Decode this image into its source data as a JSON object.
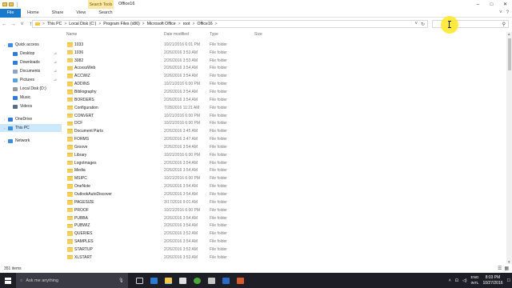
{
  "window": {
    "title": "Office16",
    "context_tab": "Search Tools",
    "controls": {
      "minimize": "–",
      "maximize": "□",
      "close": "✕"
    }
  },
  "ribbon": {
    "tabs": [
      "File",
      "Home",
      "Share",
      "View",
      "Search"
    ],
    "expand_icon": "˅",
    "help_icon": "?"
  },
  "address": {
    "back_icon": "←",
    "forward_icon": "→",
    "recent_icon": "˅",
    "up_icon": "↑",
    "breadcrumb": [
      "This PC",
      "Local Disk (C:)",
      "Program Files (x86)",
      "Microsoft Office",
      "root",
      "Office16"
    ],
    "separator": ">",
    "dropdown_icon": "˅",
    "refresh_icon": "↻",
    "search_icon": "⚲"
  },
  "nav": {
    "items": [
      {
        "label": "Quick access",
        "icon": "star-icon",
        "color": "#3d8ee8",
        "indent": 0,
        "pinned": false,
        "chevron": "›"
      },
      {
        "label": "Desktop",
        "icon": "desktop-icon",
        "color": "#2f7bd6",
        "indent": 1,
        "pinned": true
      },
      {
        "label": "Downloads",
        "icon": "download-icon",
        "color": "#2f7bd6",
        "indent": 1,
        "pinned": true
      },
      {
        "label": "Documents",
        "icon": "documents-icon",
        "color": "#8aa4c4",
        "indent": 1,
        "pinned": true
      },
      {
        "label": "Pictures",
        "icon": "pictures-icon",
        "color": "#5aa0e0",
        "indent": 1,
        "pinned": true
      },
      {
        "label": "Local Disk (D:)",
        "icon": "drive-icon",
        "color": "#9a9a9a",
        "indent": 1,
        "pinned": false
      },
      {
        "label": "Music",
        "icon": "music-icon",
        "color": "#2f7bd6",
        "indent": 1,
        "pinned": false
      },
      {
        "label": "Videos",
        "icon": "videos-icon",
        "color": "#5a6a80",
        "indent": 1,
        "pinned": false
      },
      {
        "label": "OneDrive",
        "icon": "onedrive-icon",
        "color": "#2f7bd6",
        "indent": 0,
        "pinned": false,
        "chevron": "›"
      },
      {
        "label": "This PC",
        "icon": "pc-icon",
        "color": "#3c8fd8",
        "indent": 0,
        "pinned": false,
        "chevron": "›",
        "selected": true
      },
      {
        "label": "Network",
        "icon": "network-icon",
        "color": "#3c8fd8",
        "indent": 0,
        "pinned": false,
        "chevron": "›"
      }
    ],
    "pin_glyph": "⊿"
  },
  "columns": {
    "name": "Name",
    "date": "Date modified",
    "type": "Type",
    "size": "Size"
  },
  "files": [
    {
      "name": "1033",
      "date": "10/21/2016 6:01 PM",
      "type": "File folder"
    },
    {
      "name": "1036",
      "date": "2/26/2016 3:53 AM",
      "type": "File folder"
    },
    {
      "name": "3082",
      "date": "2/26/2016 3:53 AM",
      "type": "File folder"
    },
    {
      "name": "AccessWeb",
      "date": "2/26/2016 3:54 AM",
      "type": "File folder"
    },
    {
      "name": "ACCWIZ",
      "date": "2/26/2016 3:54 AM",
      "type": "File folder"
    },
    {
      "name": "ADDINS",
      "date": "10/21/2016 6:00 PM",
      "type": "File folder"
    },
    {
      "name": "Bibliography",
      "date": "2/26/2016 3:54 AM",
      "type": "File folder"
    },
    {
      "name": "BORDERS",
      "date": "2/26/2016 3:54 AM",
      "type": "File folder"
    },
    {
      "name": "Configuration",
      "date": "7/28/2016 11:21 AM",
      "type": "File folder"
    },
    {
      "name": "CONVERT",
      "date": "10/21/2016 6:00 PM",
      "type": "File folder"
    },
    {
      "name": "DCF",
      "date": "10/21/2016 6:00 PM",
      "type": "File folder"
    },
    {
      "name": "Document Parts",
      "date": "2/26/2016 3:45 AM",
      "type": "File folder"
    },
    {
      "name": "FORMS",
      "date": "2/26/2016 3:47 AM",
      "type": "File folder"
    },
    {
      "name": "Groove",
      "date": "2/26/2016 3:54 AM",
      "type": "File folder"
    },
    {
      "name": "Library",
      "date": "10/21/2016 6:00 PM",
      "type": "File folder"
    },
    {
      "name": "LogoImages",
      "date": "2/26/2016 3:54 AM",
      "type": "File folder"
    },
    {
      "name": "Media",
      "date": "2/26/2016 3:54 AM",
      "type": "File folder"
    },
    {
      "name": "MSIPC",
      "date": "10/21/2016 6:00 PM",
      "type": "File folder"
    },
    {
      "name": "OneNote",
      "date": "2/26/2016 3:54 AM",
      "type": "File folder"
    },
    {
      "name": "OutlookAutoDiscover",
      "date": "2/26/2016 3:54 AM",
      "type": "File folder"
    },
    {
      "name": "PAGESIZE",
      "date": "3/17/2016 9:01 AM",
      "type": "File folder"
    },
    {
      "name": "PROOF",
      "date": "10/21/2016 6:00 PM",
      "type": "File folder"
    },
    {
      "name": "PUBBA",
      "date": "2/26/2016 3:54 AM",
      "type": "File folder"
    },
    {
      "name": "PUBWIZ",
      "date": "2/26/2016 3:54 AM",
      "type": "File folder"
    },
    {
      "name": "QUERIES",
      "date": "2/26/2016 3:52 AM",
      "type": "File folder"
    },
    {
      "name": "SAMPLES",
      "date": "2/26/2016 3:54 AM",
      "type": "File folder"
    },
    {
      "name": "STARTUP",
      "date": "2/26/2016 3:52 AM",
      "type": "File folder"
    },
    {
      "name": "XLSTART",
      "date": "2/26/2016 3:53 AM",
      "type": "File folder"
    }
  ],
  "status": {
    "item_count": "351 items"
  },
  "taskbar": {
    "search_placeholder": "Ask me anything",
    "mic_icon": "🎙",
    "tray": {
      "language_top": "ENG",
      "language_bottom": "INTL",
      "time": "8:03 PM",
      "date": "10/27/2016",
      "up_icon": "˄",
      "notif_icon": "☐"
    }
  }
}
